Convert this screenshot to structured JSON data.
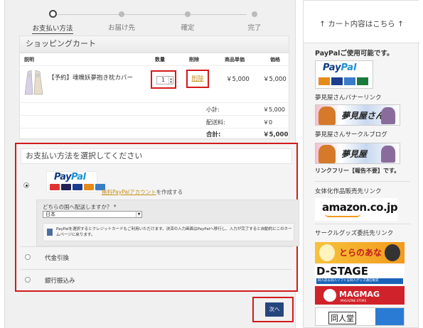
{
  "steps": [
    {
      "label": "お支払い方法",
      "current": true
    },
    {
      "label": "お届け先",
      "current": false
    },
    {
      "label": "確定",
      "current": false
    },
    {
      "label": "完了",
      "current": false
    }
  ],
  "cart": {
    "title": "ショッピングカート",
    "columns": {
      "desc": "説明",
      "qty": "数量",
      "del": "削除",
      "price": "商品単価",
      "amount": "価格"
    },
    "item": {
      "name": "【予約】魂魄妖夢抱き枕カバー",
      "qty": "1",
      "delete": "削除",
      "price": "￥5,000",
      "amount": "￥5,000"
    },
    "subtotal_label": "小計:",
    "subtotal": "￥5,000",
    "shipping_label": "配送料:",
    "shipping": "￥0",
    "total_label": "合計:",
    "total": "￥5,000"
  },
  "payment": {
    "title": "お支払い方法を選択してください",
    "paypal_word_a": "Pay",
    "paypal_word_b": "Pal",
    "paypal_link": "無料PayPalアカウント",
    "paypal_link_suffix": "を作成する",
    "country_q": "どちらの国へ配送しますか？ *",
    "country_value": "日本",
    "notice": "PayPalを選択するとクレジットカードもご利用いただけます。決済の入力画面はPayPalへ移行し、入力が完了すると自動的にこのホームページに戻ります。",
    "options": [
      "代金引換",
      "銀行振込み"
    ]
  },
  "next_label": "次へ",
  "sidebar": {
    "head": "↑ カート内容はこちら ↑",
    "paypal_ok": "PayPalご使用可能です。",
    "yumemiya_banner": "夢見屋さんバナーリンク",
    "yumemiya_blog": "夢見屋さんサークルブログ",
    "link_free": "リンクフリー【報告不要】です。",
    "female_shop": "女体化作品販売先リンク",
    "circle_goods": "サークルグッズ委託先リンク",
    "banner_text": {
      "yume1": "夢見屋さん",
      "yume2": "夢見屋",
      "amazon": "amazon.co.jp",
      "tora": "とらのあな",
      "dstage": "D-STAGE",
      "dstage_sub": "同人誌＆同人ソフト＆同人グッズ通信販売",
      "magmag": "MAGMAG",
      "magmag_sub": "MAGAZINE STORE",
      "doujin": "同人堂"
    }
  },
  "colors": {
    "highlight": "#d31a1a",
    "link": "#c8901c",
    "next_button": "#26457d"
  }
}
